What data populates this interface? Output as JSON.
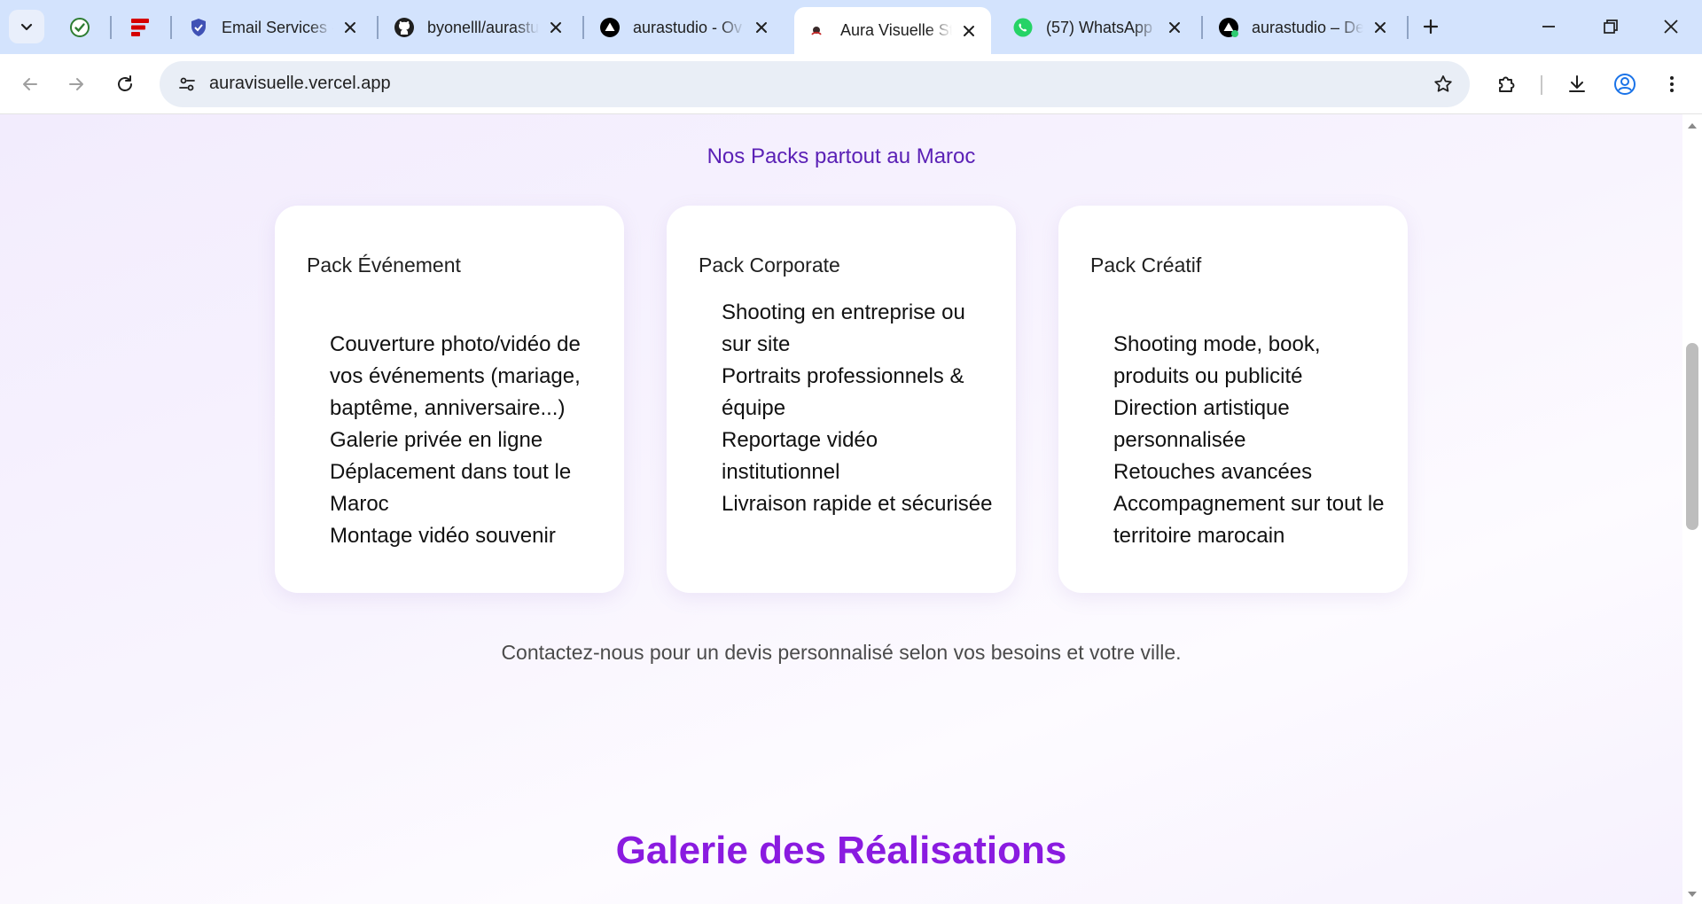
{
  "tabs": [
    {
      "title": "",
      "icon": "circle-check-icon",
      "pinned": true
    },
    {
      "title": "",
      "icon": "red-stack-icon",
      "pinned": true
    },
    {
      "title": "Email Services -",
      "icon": "shield-icon",
      "active": false
    },
    {
      "title": "byonelll/aurastu",
      "icon": "github-icon",
      "active": false
    },
    {
      "title": "aurastudio - Ov",
      "icon": "vercel-icon",
      "active": false
    },
    {
      "title": "Aura Visuelle St",
      "icon": "aura-icon",
      "active": true
    },
    {
      "title": "(57) WhatsApp",
      "icon": "whatsapp-icon",
      "active": false
    },
    {
      "title": "aurastudio – De",
      "icon": "vercel-icon",
      "active": false
    }
  ],
  "toolbar": {
    "url": "auravisuelle.vercel.app"
  },
  "content": {
    "section_subtitle": "Nos Packs partout au Maroc",
    "packs": [
      {
        "title": "Pack Événement",
        "items": [
          "Couverture photo/vidéo de vos événements (mariage, baptême, anniversaire...)",
          "Galerie privée en ligne",
          "Déplacement dans tout le Maroc",
          "Montage vidéo souvenir"
        ]
      },
      {
        "title": "Pack Corporate",
        "items": [
          "Shooting en entreprise ou sur site",
          "Portraits professionnels & équipe",
          "Reportage vidéo institutionnel",
          "Livraison rapide et sécurisée"
        ]
      },
      {
        "title": "Pack Créatif",
        "items": [
          "Shooting mode, book, produits ou publicité",
          "Direction artistique personnalisée",
          "Retouches avancées",
          "Accompagnement sur tout le territoire marocain"
        ]
      }
    ],
    "contact_note": "Contactez-nous pour un devis personnalisé selon vos besoins et votre ville.",
    "gallery_title": "Galerie des Réalisations"
  },
  "colors": {
    "accent_purple": "#8a1be0",
    "subtitle_purple": "#5b21b6",
    "tabstrip_bg": "#d3e3fd"
  }
}
